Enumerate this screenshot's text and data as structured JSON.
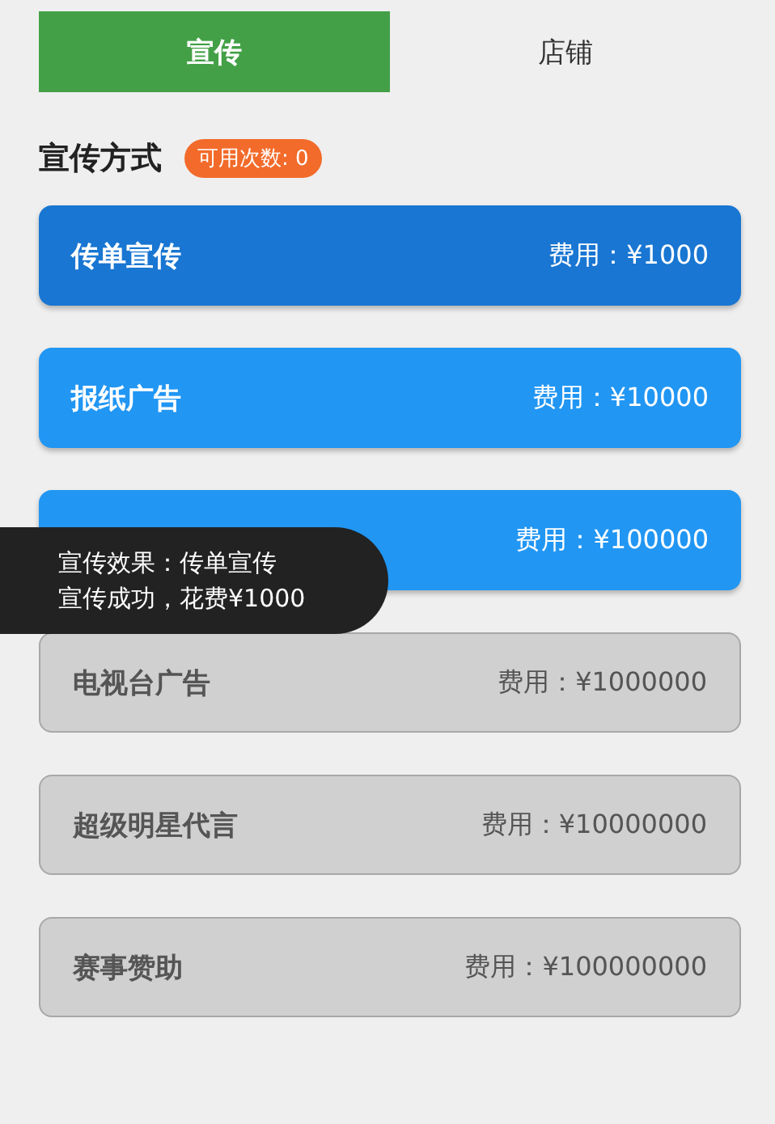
{
  "tabs": [
    {
      "label": "宣传",
      "selected": true
    },
    {
      "label": "店铺",
      "selected": false
    }
  ],
  "section": {
    "title": "宣传方式",
    "badge": "可用次数: 0"
  },
  "options": [
    {
      "name": "传单宣传",
      "cost": "费用：¥1000",
      "selected": true,
      "disabled": false
    },
    {
      "name": "报纸广告",
      "cost": "费用：¥10000",
      "selected": false,
      "disabled": false
    },
    {
      "cost": "费用：¥100000",
      "selected": false,
      "disabled": false
    },
    {
      "name": "电视台广告",
      "cost": "费用：¥1000000",
      "selected": false,
      "disabled": true
    },
    {
      "name": "超级明星代言",
      "cost": "费用：¥10000000",
      "selected": false,
      "disabled": true
    },
    {
      "name": "赛事赞助",
      "cost": "费用：¥100000000",
      "selected": false,
      "disabled": true
    }
  ],
  "toast": {
    "lines": [
      "宣传效果：传单宣传",
      "宣传成功，花费¥1000"
    ]
  }
}
